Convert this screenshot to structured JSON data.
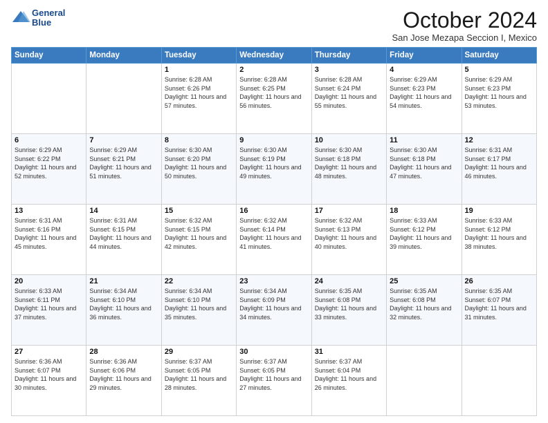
{
  "header": {
    "logo_line1": "General",
    "logo_line2": "Blue",
    "month_title": "October 2024",
    "subtitle": "San Jose Mezapa Seccion I, Mexico"
  },
  "weekdays": [
    "Sunday",
    "Monday",
    "Tuesday",
    "Wednesday",
    "Thursday",
    "Friday",
    "Saturday"
  ],
  "weeks": [
    [
      {
        "day": "",
        "info": ""
      },
      {
        "day": "",
        "info": ""
      },
      {
        "day": "1",
        "info": "Sunrise: 6:28 AM\nSunset: 6:26 PM\nDaylight: 11 hours and 57 minutes."
      },
      {
        "day": "2",
        "info": "Sunrise: 6:28 AM\nSunset: 6:25 PM\nDaylight: 11 hours and 56 minutes."
      },
      {
        "day": "3",
        "info": "Sunrise: 6:28 AM\nSunset: 6:24 PM\nDaylight: 11 hours and 55 minutes."
      },
      {
        "day": "4",
        "info": "Sunrise: 6:29 AM\nSunset: 6:23 PM\nDaylight: 11 hours and 54 minutes."
      },
      {
        "day": "5",
        "info": "Sunrise: 6:29 AM\nSunset: 6:23 PM\nDaylight: 11 hours and 53 minutes."
      }
    ],
    [
      {
        "day": "6",
        "info": "Sunrise: 6:29 AM\nSunset: 6:22 PM\nDaylight: 11 hours and 52 minutes."
      },
      {
        "day": "7",
        "info": "Sunrise: 6:29 AM\nSunset: 6:21 PM\nDaylight: 11 hours and 51 minutes."
      },
      {
        "day": "8",
        "info": "Sunrise: 6:30 AM\nSunset: 6:20 PM\nDaylight: 11 hours and 50 minutes."
      },
      {
        "day": "9",
        "info": "Sunrise: 6:30 AM\nSunset: 6:19 PM\nDaylight: 11 hours and 49 minutes."
      },
      {
        "day": "10",
        "info": "Sunrise: 6:30 AM\nSunset: 6:18 PM\nDaylight: 11 hours and 48 minutes."
      },
      {
        "day": "11",
        "info": "Sunrise: 6:30 AM\nSunset: 6:18 PM\nDaylight: 11 hours and 47 minutes."
      },
      {
        "day": "12",
        "info": "Sunrise: 6:31 AM\nSunset: 6:17 PM\nDaylight: 11 hours and 46 minutes."
      }
    ],
    [
      {
        "day": "13",
        "info": "Sunrise: 6:31 AM\nSunset: 6:16 PM\nDaylight: 11 hours and 45 minutes."
      },
      {
        "day": "14",
        "info": "Sunrise: 6:31 AM\nSunset: 6:15 PM\nDaylight: 11 hours and 44 minutes."
      },
      {
        "day": "15",
        "info": "Sunrise: 6:32 AM\nSunset: 6:15 PM\nDaylight: 11 hours and 42 minutes."
      },
      {
        "day": "16",
        "info": "Sunrise: 6:32 AM\nSunset: 6:14 PM\nDaylight: 11 hours and 41 minutes."
      },
      {
        "day": "17",
        "info": "Sunrise: 6:32 AM\nSunset: 6:13 PM\nDaylight: 11 hours and 40 minutes."
      },
      {
        "day": "18",
        "info": "Sunrise: 6:33 AM\nSunset: 6:12 PM\nDaylight: 11 hours and 39 minutes."
      },
      {
        "day": "19",
        "info": "Sunrise: 6:33 AM\nSunset: 6:12 PM\nDaylight: 11 hours and 38 minutes."
      }
    ],
    [
      {
        "day": "20",
        "info": "Sunrise: 6:33 AM\nSunset: 6:11 PM\nDaylight: 11 hours and 37 minutes."
      },
      {
        "day": "21",
        "info": "Sunrise: 6:34 AM\nSunset: 6:10 PM\nDaylight: 11 hours and 36 minutes."
      },
      {
        "day": "22",
        "info": "Sunrise: 6:34 AM\nSunset: 6:10 PM\nDaylight: 11 hours and 35 minutes."
      },
      {
        "day": "23",
        "info": "Sunrise: 6:34 AM\nSunset: 6:09 PM\nDaylight: 11 hours and 34 minutes."
      },
      {
        "day": "24",
        "info": "Sunrise: 6:35 AM\nSunset: 6:08 PM\nDaylight: 11 hours and 33 minutes."
      },
      {
        "day": "25",
        "info": "Sunrise: 6:35 AM\nSunset: 6:08 PM\nDaylight: 11 hours and 32 minutes."
      },
      {
        "day": "26",
        "info": "Sunrise: 6:35 AM\nSunset: 6:07 PM\nDaylight: 11 hours and 31 minutes."
      }
    ],
    [
      {
        "day": "27",
        "info": "Sunrise: 6:36 AM\nSunset: 6:07 PM\nDaylight: 11 hours and 30 minutes."
      },
      {
        "day": "28",
        "info": "Sunrise: 6:36 AM\nSunset: 6:06 PM\nDaylight: 11 hours and 29 minutes."
      },
      {
        "day": "29",
        "info": "Sunrise: 6:37 AM\nSunset: 6:05 PM\nDaylight: 11 hours and 28 minutes."
      },
      {
        "day": "30",
        "info": "Sunrise: 6:37 AM\nSunset: 6:05 PM\nDaylight: 11 hours and 27 minutes."
      },
      {
        "day": "31",
        "info": "Sunrise: 6:37 AM\nSunset: 6:04 PM\nDaylight: 11 hours and 26 minutes."
      },
      {
        "day": "",
        "info": ""
      },
      {
        "day": "",
        "info": ""
      }
    ]
  ]
}
